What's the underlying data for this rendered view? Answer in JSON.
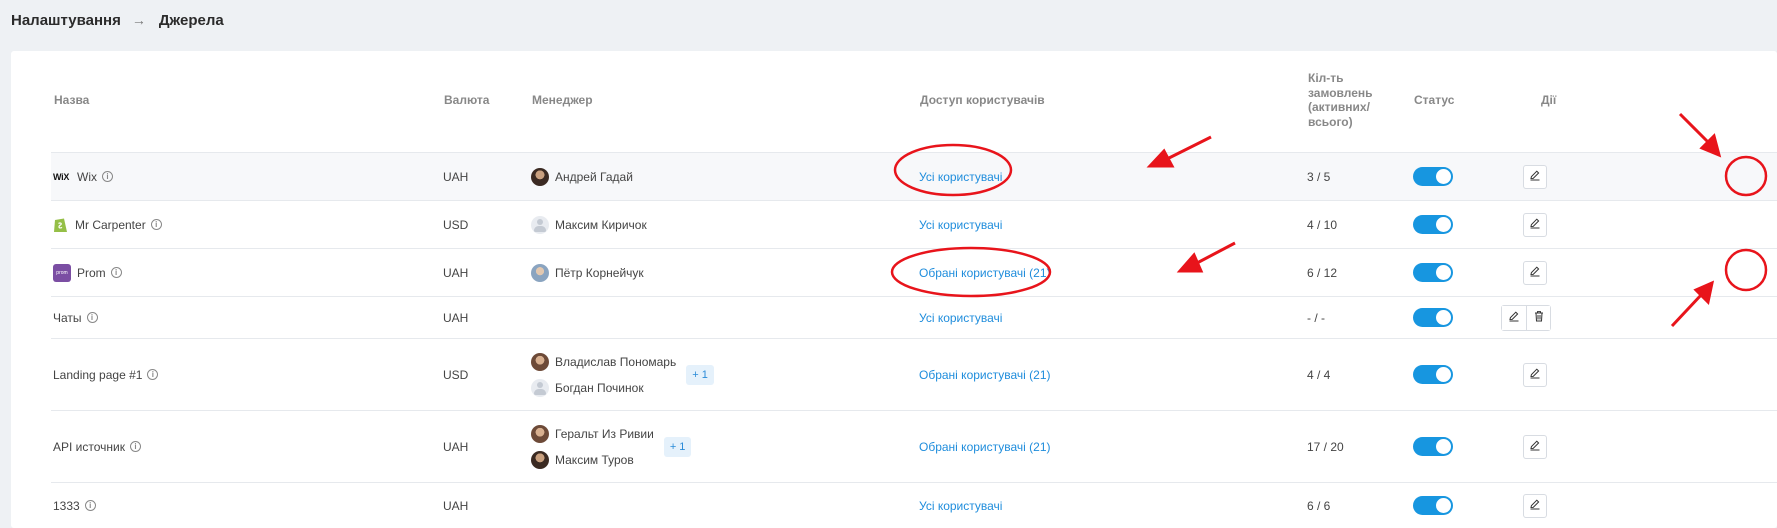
{
  "breadcrumb": {
    "parent": "Налаштування",
    "separator": "→",
    "current": "Джерела"
  },
  "table": {
    "headers": {
      "name": "Назва",
      "currency": "Валюта",
      "manager": "Менеджер",
      "access": "Доступ користувачів",
      "orders_line1": "Кіл-ть",
      "orders_line2": "замовлень",
      "orders_line3": "(активних/",
      "orders_line4": "всього)",
      "status": "Статус",
      "actions": "Дії"
    },
    "rows": [
      {
        "icon": "wix-logo",
        "icon_text": "WiX",
        "name": "Wix",
        "currency": "UAH",
        "managers": [
          "Андрей Гадай"
        ],
        "access": "Усі користувачі",
        "orders": "3 / 5",
        "status": "on"
      },
      {
        "icon": "shopify-logo",
        "name": "Mr Carpenter",
        "currency": "USD",
        "managers": [
          "Максим Киричок"
        ],
        "access": "Усі користувачі",
        "orders": "4 / 10",
        "status": "on"
      },
      {
        "icon": "prom-logo",
        "icon_text": "prom",
        "name": "Prom",
        "currency": "UAH",
        "managers": [
          "Пётр Корнейчук"
        ],
        "access": "Обрані користувачі (21)",
        "orders": "6 / 12",
        "status": "on"
      },
      {
        "name": "Чаты",
        "currency": "UAH",
        "managers": [],
        "access": "Усі користувачі",
        "orders": "- / -",
        "status": "on"
      },
      {
        "name": "Landing page #1",
        "currency": "USD",
        "managers": [
          "Владислав Пономарь",
          "Богдан Починок"
        ],
        "extra_managers": "+ 1",
        "access": "Обрані користувачі (21)",
        "orders": "4 / 4",
        "status": "on"
      },
      {
        "name": "API источник",
        "currency": "UAH",
        "managers": [
          "Геральт Из Ривии",
          "Максим Туров"
        ],
        "extra_managers": "+ 1",
        "access": "Обрані користувачі (21)",
        "orders": "17 / 20",
        "status": "on"
      },
      {
        "name": "1333",
        "currency": "UAH",
        "managers": [],
        "access": "Усі користувачі",
        "orders": "6 / 6",
        "status": "on"
      }
    ]
  },
  "colors": {
    "link": "#1f8ddc",
    "toggle_on": "#1796e0",
    "annotation": "#e8141b"
  },
  "icons": {
    "edit": "pencil-icon",
    "delete": "trash-icon",
    "info": "info-icon"
  }
}
